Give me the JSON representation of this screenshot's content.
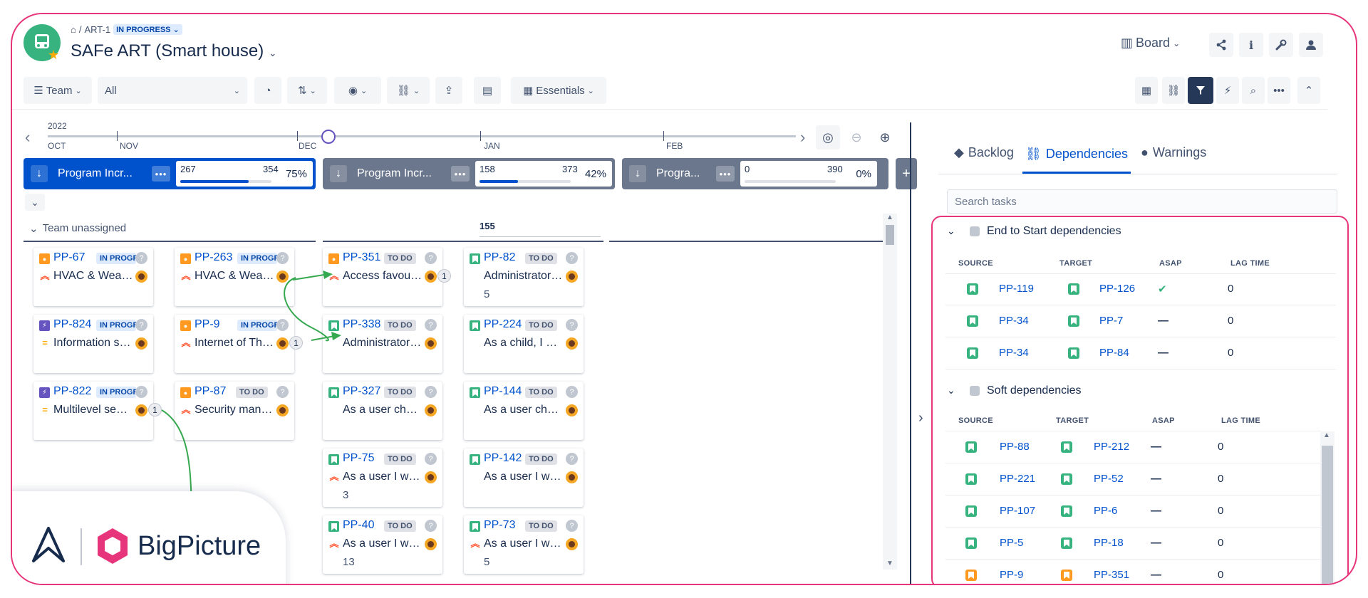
{
  "header": {
    "breadcrumb_sep": "/",
    "breadcrumb_key": "ART-1",
    "status": "IN PROGRESS",
    "title": "SAFe ART (Smart house)",
    "view": "Board"
  },
  "toolbar": {
    "team": "Team",
    "filter_value": "All",
    "essentials": "Essentials"
  },
  "timeline": {
    "year": "2022",
    "months": [
      "OCT",
      "NOV",
      "DEC",
      "JAN",
      "FEB"
    ]
  },
  "increments": [
    {
      "name": "Program Incr...",
      "done": "267",
      "total": "354",
      "pct": "75%",
      "progress": 0.75,
      "color": "#0052cc"
    },
    {
      "name": "Program Incr...",
      "done": "158",
      "total": "373",
      "pct": "42%",
      "progress": 0.42,
      "color": "#6b778c"
    },
    {
      "name": "Progra...",
      "done": "0",
      "total": "390",
      "pct": "0%",
      "progress": 0,
      "color": "#6b778c"
    }
  ],
  "board": {
    "swimlane": "Team unassigned",
    "column_count": "155",
    "col1": [
      {
        "key": "PP-67",
        "type": "idea",
        "status": "IN PROGRESS",
        "status_kind": "ip",
        "priority": "high",
        "summary": "HVAC & Weather monitoring"
      },
      {
        "key": "PP-824",
        "type": "epic",
        "status": "IN PROGRESS",
        "status_kind": "ip",
        "priority": "medium",
        "summary": "Information system"
      },
      {
        "key": "PP-822",
        "type": "epic",
        "status": "IN PROGRESS",
        "status_kind": "ip",
        "priority": "medium",
        "summary": "Multilevel security",
        "links": "1"
      }
    ],
    "col2": [
      {
        "key": "PP-263",
        "type": "idea",
        "status": "IN PROGRESS",
        "status_kind": "ip",
        "priority": "high",
        "summary": "HVAC & Weather monitoring"
      },
      {
        "key": "PP-9",
        "type": "idea",
        "status": "IN PROGRESS",
        "status_kind": "ip",
        "priority": "high",
        "summary": "Internet of Things",
        "links": "1"
      },
      {
        "key": "PP-87",
        "type": "idea",
        "status": "TO DO",
        "status_kind": "td",
        "priority": "high",
        "summary": "Security management"
      }
    ],
    "col3": [
      {
        "key": "PP-351",
        "type": "idea",
        "status": "TO DO",
        "status_kind": "td",
        "priority": "high",
        "summary": "Access favourites",
        "links": "1"
      },
      {
        "key": "PP-338",
        "type": "story",
        "status": "TO DO",
        "status_kind": "td",
        "priority": "none",
        "summary": "Administrator can"
      },
      {
        "key": "PP-327",
        "type": "story",
        "status": "TO DO",
        "status_kind": "td",
        "priority": "none",
        "summary": "As a user check status"
      },
      {
        "key": "PP-75",
        "type": "story",
        "status": "TO DO",
        "status_kind": "td",
        "priority": "high",
        "summary": "As a user I want",
        "points": "3"
      },
      {
        "key": "PP-40",
        "type": "story",
        "status": "TO DO",
        "status_kind": "td",
        "priority": "high",
        "summary": "As a user I want",
        "points": "13"
      }
    ],
    "col4": [
      {
        "key": "PP-82",
        "type": "story",
        "status": "TO DO",
        "status_kind": "td",
        "priority": "none",
        "summary": "Administrator can",
        "points": "5"
      },
      {
        "key": "PP-224",
        "type": "story",
        "status": "TO DO",
        "status_kind": "td",
        "priority": "none",
        "summary": "As a child, I want"
      },
      {
        "key": "PP-144",
        "type": "story",
        "status": "TO DO",
        "status_kind": "td",
        "priority": "none",
        "summary": "As a user check status"
      },
      {
        "key": "PP-142",
        "type": "story",
        "status": "TO DO",
        "status_kind": "td",
        "priority": "none",
        "summary": "As a user I want"
      },
      {
        "key": "PP-73",
        "type": "story",
        "status": "TO DO",
        "status_kind": "td",
        "priority": "high",
        "summary": "As a user I want",
        "points": "5"
      }
    ]
  },
  "panel": {
    "tabs": [
      "Backlog",
      "Dependencies",
      "Warnings"
    ],
    "search_placeholder": "Search tasks",
    "columns": [
      "SOURCE",
      "TARGET",
      "ASAP",
      "LAG TIME"
    ],
    "end_to_start": {
      "title": "End to Start dependencies",
      "rows": [
        {
          "source": "PP-119",
          "source_type": "story",
          "target": "PP-126",
          "target_type": "story",
          "asap": "✔",
          "lag": "0"
        },
        {
          "source": "PP-34",
          "source_type": "story",
          "target": "PP-7",
          "target_type": "story",
          "asap": "—",
          "lag": "0"
        },
        {
          "source": "PP-34",
          "source_type": "story",
          "target": "PP-84",
          "target_type": "story",
          "asap": "—",
          "lag": "0"
        }
      ]
    },
    "soft": {
      "title": "Soft dependencies",
      "rows": [
        {
          "source": "PP-88",
          "source_type": "story",
          "target": "PP-212",
          "target_type": "story",
          "asap": "—",
          "lag": "0"
        },
        {
          "source": "PP-221",
          "source_type": "story",
          "target": "PP-52",
          "target_type": "story",
          "asap": "—",
          "lag": "0"
        },
        {
          "source": "PP-107",
          "source_type": "story",
          "target": "PP-6",
          "target_type": "story",
          "asap": "—",
          "lag": "0"
        },
        {
          "source": "PP-5",
          "source_type": "story",
          "target": "PP-18",
          "target_type": "story",
          "asap": "—",
          "lag": "0"
        },
        {
          "source": "PP-9",
          "source_type": "idea",
          "target": "PP-351",
          "target_type": "idea",
          "asap": "—",
          "lag": "0"
        }
      ]
    }
  },
  "brand": {
    "name": "BigPicture",
    "accent": "#e6357a"
  }
}
